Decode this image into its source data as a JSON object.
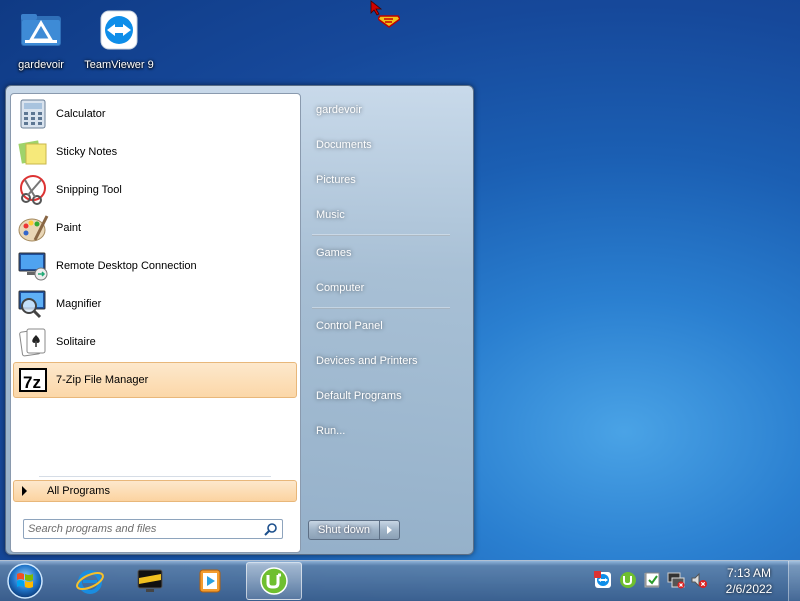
{
  "desktop": {
    "icons": [
      {
        "label": "gardevoir",
        "icon": "folder-icon"
      },
      {
        "label": "TeamViewer 9",
        "icon": "teamviewer-icon"
      }
    ]
  },
  "start_menu": {
    "programs": [
      {
        "label": "Calculator",
        "icon": "calculator-icon"
      },
      {
        "label": "Sticky Notes",
        "icon": "sticky-notes-icon"
      },
      {
        "label": "Snipping Tool",
        "icon": "scissors-icon"
      },
      {
        "label": "Paint",
        "icon": "paint-palette-icon"
      },
      {
        "label": "Remote Desktop Connection",
        "icon": "remote-desktop-icon"
      },
      {
        "label": "Magnifier",
        "icon": "magnifier-icon"
      },
      {
        "label": "Solitaire",
        "icon": "cards-icon"
      },
      {
        "label": "7-Zip File Manager",
        "icon": "sevenzip-icon",
        "selected": true
      }
    ],
    "all_programs_label": "All Programs",
    "search": {
      "placeholder": "Search programs and files",
      "value": ""
    },
    "right_items": [
      "gardevoir",
      "Documents",
      "Pictures",
      "Music",
      "Games",
      "Computer",
      "Control Panel",
      "Devices and Printers",
      "Default Programs",
      "Run..."
    ],
    "shutdown_label": "Shut down"
  },
  "taskbar": {
    "pinned": [
      {
        "name": "internet-explorer",
        "icon": "internet-explorer-icon"
      },
      {
        "name": "media-center",
        "icon": "media-center-icon"
      },
      {
        "name": "media-player",
        "icon": "media-player-icon"
      },
      {
        "name": "utorrent",
        "icon": "utorrent-icon",
        "active": true
      }
    ],
    "tray": [
      "teamviewer-tray-icon",
      "utorrent-tray-icon",
      "action-center-icon",
      "network-icon",
      "volume-muted-icon"
    ],
    "clock": {
      "time": "7:13 AM",
      "date": "2/6/2022"
    }
  },
  "colors": {
    "selection": "#fbd7a8",
    "taskbar": "#3c5f8c",
    "desktop": "#1b5fb3"
  }
}
